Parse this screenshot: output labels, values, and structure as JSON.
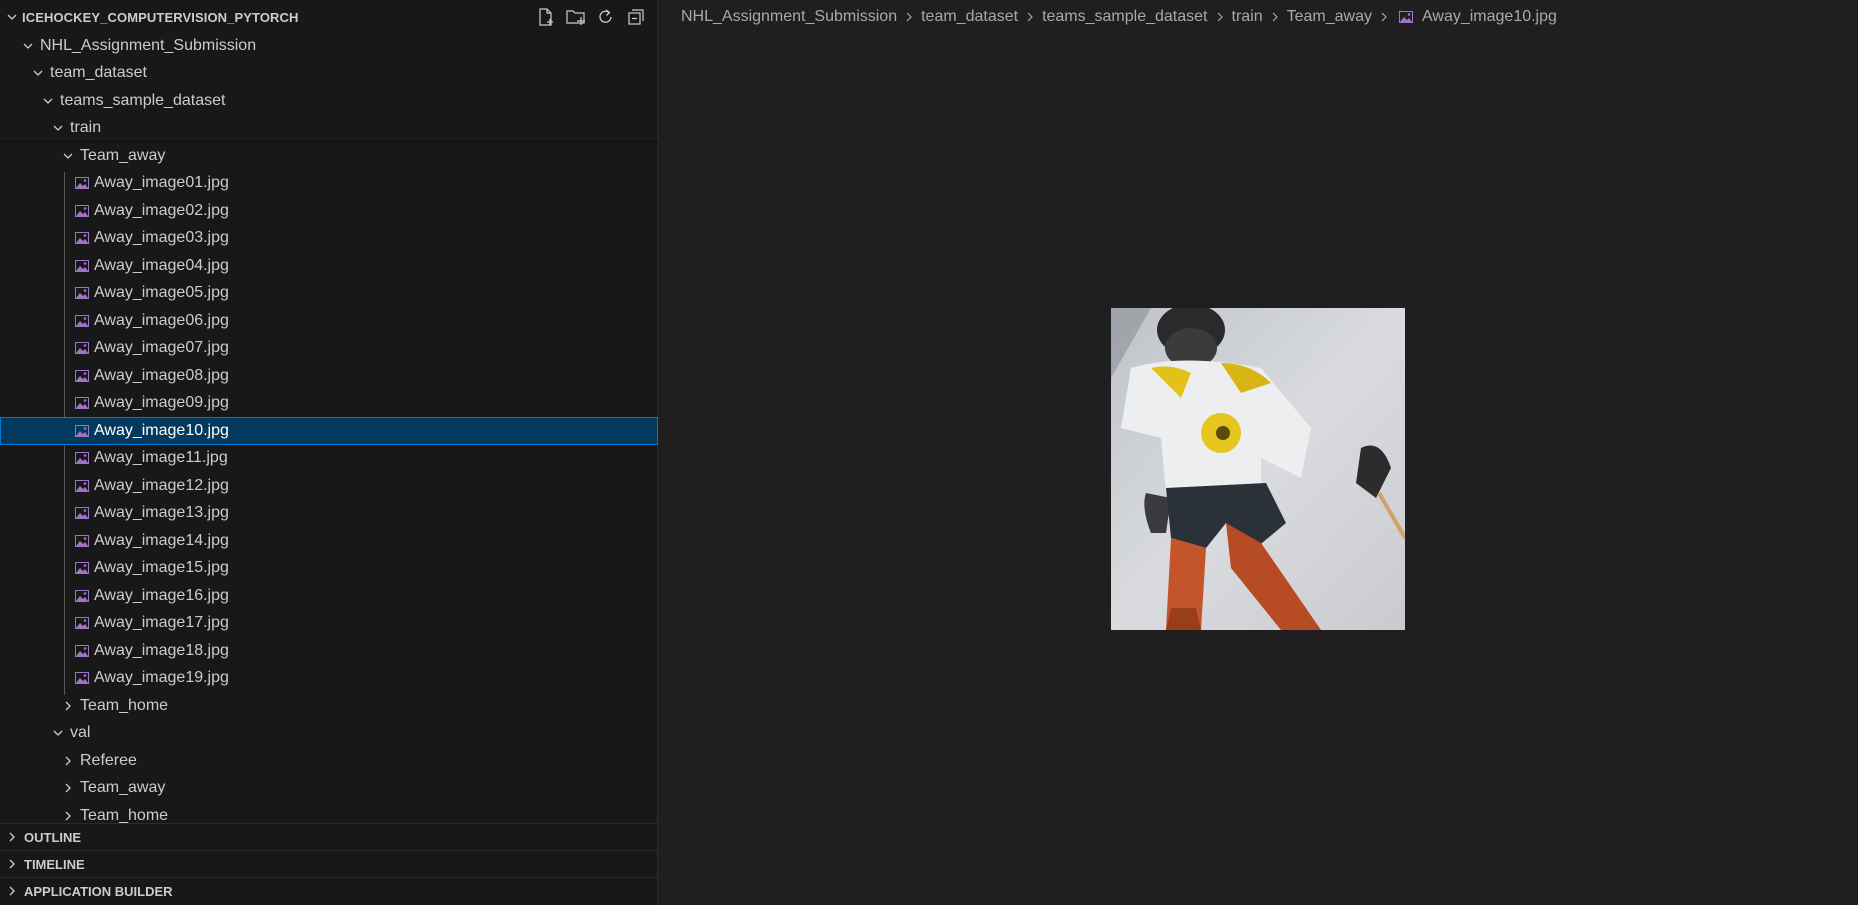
{
  "explorer": {
    "title": "ICEHOCKEY_COMPUTERVISION_PYTORCH",
    "actions": [
      {
        "name": "new-file-icon"
      },
      {
        "name": "new-folder-icon"
      },
      {
        "name": "refresh-icon"
      },
      {
        "name": "collapse-all-icon"
      }
    ]
  },
  "tree": [
    {
      "label": "NHL_Assignment_Submission",
      "depth": 1,
      "type": "folder",
      "expanded": true
    },
    {
      "label": "team_dataset",
      "depth": 2,
      "type": "folder",
      "expanded": true
    },
    {
      "label": "teams_sample_dataset",
      "depth": 3,
      "type": "folder",
      "expanded": true
    },
    {
      "label": "train",
      "depth": 4,
      "type": "folder",
      "expanded": true
    },
    {
      "label": "Team_away",
      "depth": 5,
      "type": "folder",
      "expanded": true
    },
    {
      "label": "Away_image01.jpg",
      "depth": 6,
      "type": "image"
    },
    {
      "label": "Away_image02.jpg",
      "depth": 6,
      "type": "image"
    },
    {
      "label": "Away_image03.jpg",
      "depth": 6,
      "type": "image"
    },
    {
      "label": "Away_image04.jpg",
      "depth": 6,
      "type": "image"
    },
    {
      "label": "Away_image05.jpg",
      "depth": 6,
      "type": "image"
    },
    {
      "label": "Away_image06.jpg",
      "depth": 6,
      "type": "image"
    },
    {
      "label": "Away_image07.jpg",
      "depth": 6,
      "type": "image"
    },
    {
      "label": "Away_image08.jpg",
      "depth": 6,
      "type": "image"
    },
    {
      "label": "Away_image09.jpg",
      "depth": 6,
      "type": "image"
    },
    {
      "label": "Away_image10.jpg",
      "depth": 6,
      "type": "image",
      "selected": true
    },
    {
      "label": "Away_image11.jpg",
      "depth": 6,
      "type": "image"
    },
    {
      "label": "Away_image12.jpg",
      "depth": 6,
      "type": "image"
    },
    {
      "label": "Away_image13.jpg",
      "depth": 6,
      "type": "image"
    },
    {
      "label": "Away_image14.jpg",
      "depth": 6,
      "type": "image"
    },
    {
      "label": "Away_image15.jpg",
      "depth": 6,
      "type": "image"
    },
    {
      "label": "Away_image16.jpg",
      "depth": 6,
      "type": "image"
    },
    {
      "label": "Away_image17.jpg",
      "depth": 6,
      "type": "image"
    },
    {
      "label": "Away_image18.jpg",
      "depth": 6,
      "type": "image"
    },
    {
      "label": "Away_image19.jpg",
      "depth": 6,
      "type": "image"
    },
    {
      "label": "Team_home",
      "depth": 5,
      "type": "folder",
      "expanded": false
    },
    {
      "label": "val",
      "depth": 4,
      "type": "folder",
      "expanded": true
    },
    {
      "label": "Referee",
      "depth": 5,
      "type": "folder",
      "expanded": false
    },
    {
      "label": "Team_away",
      "depth": 5,
      "type": "folder",
      "expanded": false
    },
    {
      "label": "Team_home",
      "depth": 5,
      "type": "folder",
      "expanded": false
    }
  ],
  "panels": [
    {
      "label": "OUTLINE"
    },
    {
      "label": "TIMELINE"
    },
    {
      "label": "APPLICATION BUILDER"
    }
  ],
  "breadcrumb": {
    "items": [
      "NHL_Assignment_Submission",
      "team_dataset",
      "teams_sample_dataset",
      "train",
      "Team_away"
    ],
    "file": "Away_image10.jpg"
  },
  "colors": {
    "sidebar_bg": "#181818",
    "editor_bg": "#1f1f1f",
    "selection_bg": "#04395e",
    "selection_border": "#0078d4",
    "image_icon": "#a074c4"
  }
}
